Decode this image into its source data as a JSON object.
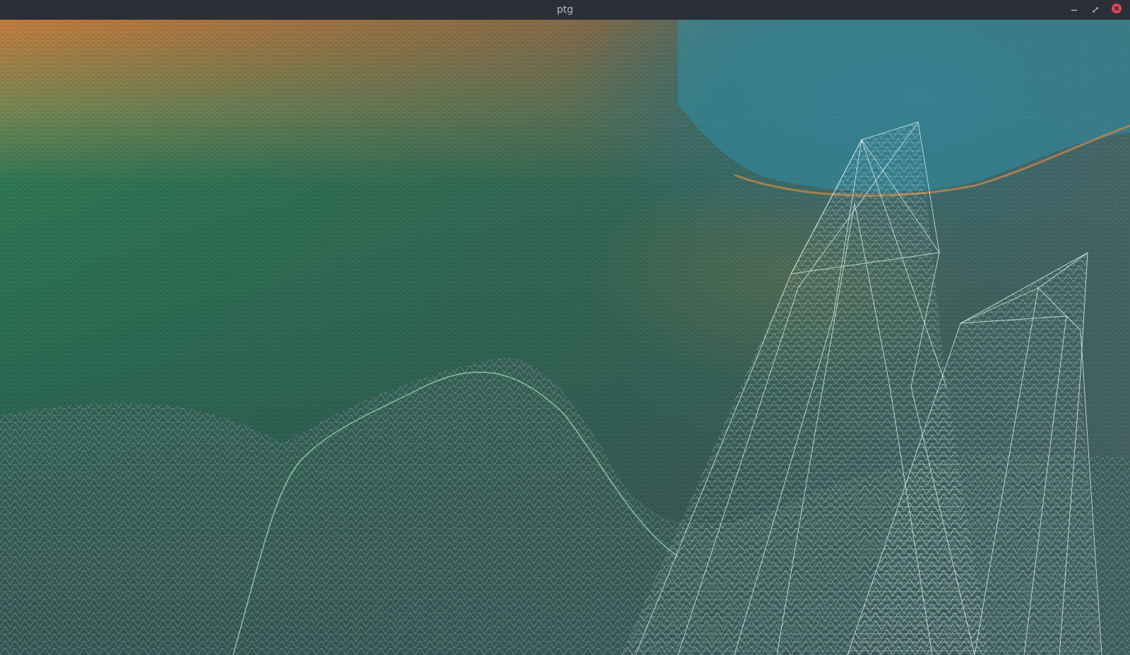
{
  "window": {
    "title": "ptg",
    "controls": {
      "minimize_icon": "minimize-icon",
      "restore_icon": "restore-icon",
      "close_icon": "close-icon"
    },
    "close_color": "#e0465a"
  },
  "scene": {
    "description_icon": "wireframe-terrain",
    "palette": {
      "orange": "#c9803f",
      "green": "#2d7a55",
      "teal": "#2f8a9a",
      "blue": "#3aa6c8",
      "slate": "#33504f",
      "wire_light": "#d8e6e6"
    }
  }
}
